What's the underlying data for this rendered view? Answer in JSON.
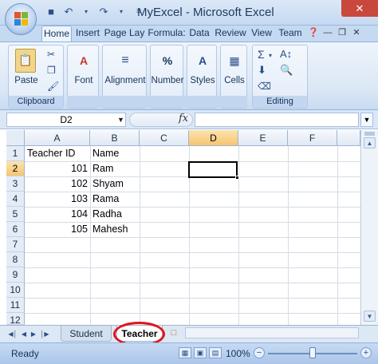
{
  "window": {
    "title": "MyExcel - Microsoft Excel",
    "close_glyph": "✕"
  },
  "qat": {
    "save_icon": "save-icon",
    "undo_icon": "undo-icon",
    "redo_icon": "redo-icon",
    "customize_icon": "customize-qat-icon"
  },
  "tabs": [
    "Home",
    "Insert",
    "Page Lay",
    "Formula:",
    "Data",
    "Review",
    "View",
    "Team"
  ],
  "ribbon": {
    "clipboard": {
      "label": "Clipboard",
      "paste": "Paste"
    },
    "font": {
      "label": "Font"
    },
    "alignment": {
      "label": "Alignment"
    },
    "number": {
      "label": "Number"
    },
    "styles": {
      "label": "Styles"
    },
    "cells": {
      "label": "Cells"
    },
    "editing": {
      "label": "Editing"
    }
  },
  "formula_bar": {
    "name_box": "D2",
    "fx": "fx",
    "formula": ""
  },
  "sheet": {
    "columns": [
      "A",
      "B",
      "C",
      "D",
      "E",
      "F"
    ],
    "selected_column": "D",
    "rows": [
      "1",
      "2",
      "3",
      "4",
      "5",
      "6",
      "7",
      "8",
      "9",
      "10",
      "11",
      "12"
    ],
    "selected_row": "2",
    "cells": [
      [
        "Teacher ID",
        "Name"
      ],
      [
        "101",
        "Ram"
      ],
      [
        "102",
        "Shyam"
      ],
      [
        "103",
        "Rama"
      ],
      [
        "104",
        "Radha"
      ],
      [
        "105",
        "Mahesh"
      ]
    ]
  },
  "sheet_tabs": {
    "tabs": [
      "Student",
      "Teacher"
    ],
    "active": "Teacher"
  },
  "status_bar": {
    "status": "Ready",
    "zoom": "100%",
    "zoom_level_percent": 100
  },
  "colors": {
    "accent": "#c5d9f1",
    "highlight_ring": "#e0141b",
    "selected_header": "#f6c56e"
  }
}
